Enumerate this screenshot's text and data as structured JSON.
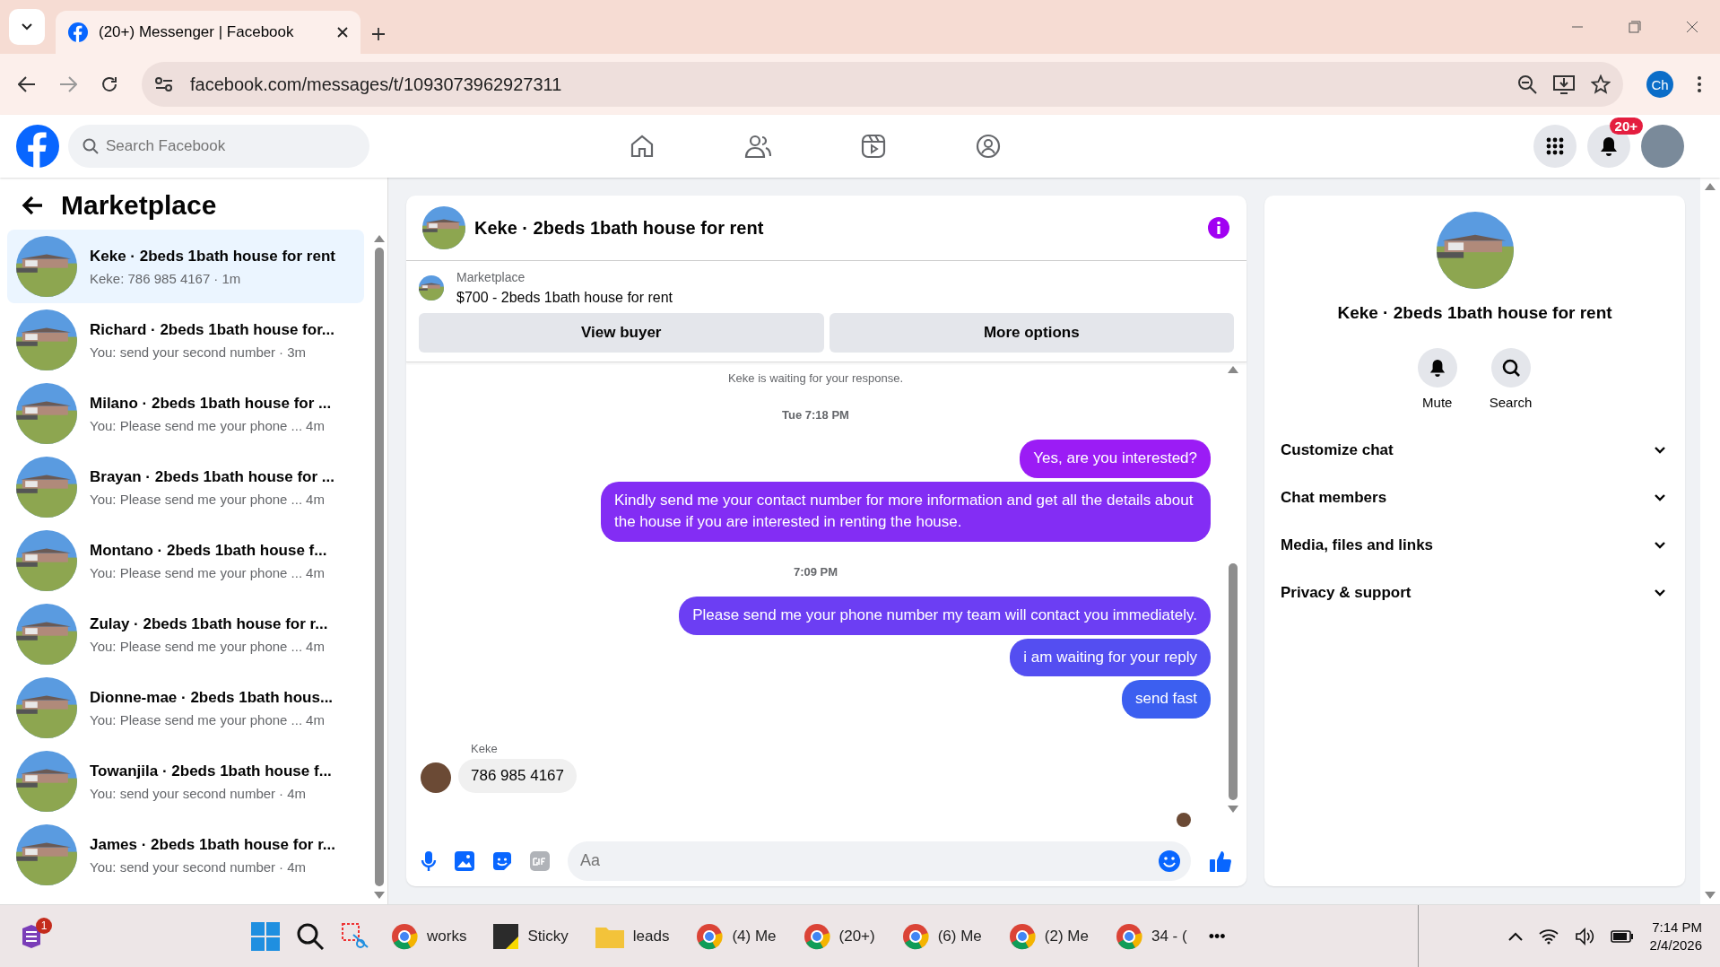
{
  "browser": {
    "tab_title": "(20+) Messenger | Facebook",
    "url": "facebook.com/messages/t/1093073962927311",
    "profile": "Ch"
  },
  "header": {
    "search_placeholder": "Search Facebook",
    "notifications_badge": "20+"
  },
  "sidebar": {
    "title": "Marketplace",
    "conversations": [
      {
        "title": "Keke · 2beds 1bath house for rent",
        "preview": "Keke: 786 985 4167",
        "time": "· 1m",
        "selected": true
      },
      {
        "title": "Richard · 2beds 1bath house for...",
        "preview": "You: send your second number",
        "time": "· 3m",
        "selected": false
      },
      {
        "title": "Milano · 2beds 1bath house for ...",
        "preview": "You: Please send me your phone ...",
        "time": "4m",
        "selected": false
      },
      {
        "title": "Brayan · 2beds 1bath house for ...",
        "preview": "You: Please send me your phone ...",
        "time": "4m",
        "selected": false
      },
      {
        "title": "Montano · 2beds 1bath house f...",
        "preview": "You: Please send me your phone ...",
        "time": "4m",
        "selected": false
      },
      {
        "title": "Zulay · 2beds 1bath house for r...",
        "preview": "You: Please send me your phone ...",
        "time": "4m",
        "selected": false
      },
      {
        "title": "Dionne-mae · 2beds 1bath hous...",
        "preview": "You: Please send me your phone ...",
        "time": "4m",
        "selected": false
      },
      {
        "title": "Towanjila · 2beds 1bath house f...",
        "preview": "You: send your second number",
        "time": "· 4m",
        "selected": false
      },
      {
        "title": "James · 2beds 1bath house for r...",
        "preview": "You: send your second number",
        "time": "· 4m",
        "selected": false
      }
    ]
  },
  "chat": {
    "title": "Keke · 2beds 1bath house for rent",
    "listing": {
      "source": "Marketplace",
      "name": "$700 - 2beds 1bath house for rent"
    },
    "buttons": [
      "View buyer",
      "More options"
    ],
    "messages": [
      {
        "kind": "notice",
        "text": "Keke is waiting for your response."
      },
      {
        "kind": "timestamp",
        "text": "Tue 7:18 PM"
      },
      {
        "kind": "outgoing",
        "text": "Yes, are you interested?"
      },
      {
        "kind": "outgoing",
        "text": "Kindly send me your contact number for more information and get all the details about the house if you are interested in renting the house."
      },
      {
        "kind": "timestamp",
        "text": "7:09 PM"
      },
      {
        "kind": "outgoing",
        "text": "Please send me your phone number my team will contact you immediately."
      },
      {
        "kind": "outgoing",
        "text": "i am waiting for your reply"
      },
      {
        "kind": "outgoing",
        "text": "send fast"
      },
      {
        "kind": "incoming",
        "sender": "Keke",
        "text": "786 985 4167"
      }
    ],
    "composer_placeholder": "Aa"
  },
  "details": {
    "title": "Keke · 2beds 1bath house for rent",
    "actions": [
      {
        "kind": "mute",
        "label": "Mute"
      },
      {
        "kind": "search",
        "label": "Search"
      }
    ],
    "sections": [
      "Customize chat",
      "Chat members",
      "Media, files and links",
      "Privacy & support"
    ]
  },
  "taskbar": {
    "start_badge": "1",
    "apps": [
      {
        "kind": "chrome",
        "label": "works"
      },
      {
        "kind": "sticky",
        "label": "Sticky"
      },
      {
        "kind": "folder",
        "label": "leads"
      },
      {
        "kind": "chrome",
        "label": "(4) Me"
      },
      {
        "kind": "chrome",
        "label": "(20+)"
      },
      {
        "kind": "chrome",
        "label": "(6) Me"
      },
      {
        "kind": "chrome",
        "label": "(2) Me"
      },
      {
        "kind": "chrome",
        "label": "34 - ("
      }
    ],
    "more": "•••",
    "time": "7:14 PM",
    "date": "2/4/2026"
  }
}
